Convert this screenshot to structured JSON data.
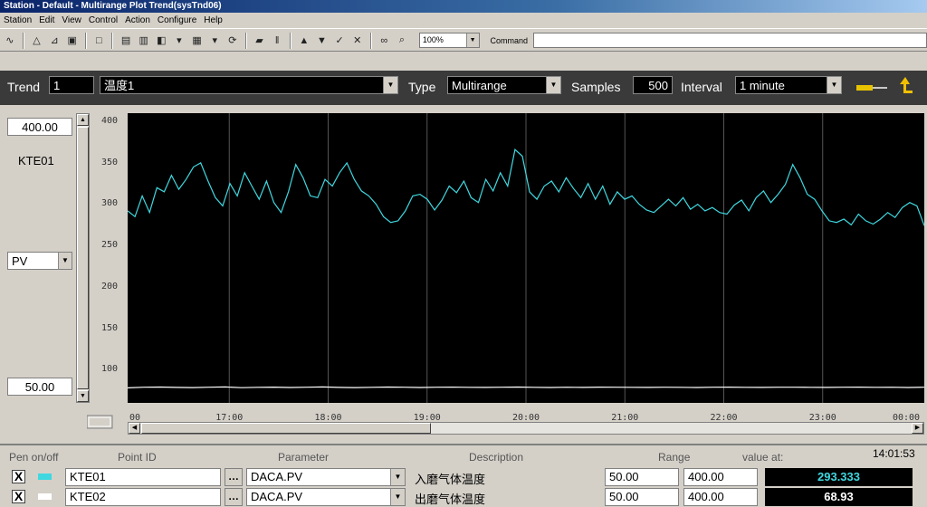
{
  "window": {
    "title": "Station - Default - Multirange Plot Trend(sysTnd06)"
  },
  "menu": [
    "Station",
    "Edit",
    "View",
    "Control",
    "Action",
    "Configure",
    "Help"
  ],
  "toolbar": {
    "zoom": "100%",
    "command_label": "Command",
    "command_value": ""
  },
  "trend": {
    "trend_label": "Trend",
    "trend_number": "1",
    "trend_name": "温度1",
    "type_label": "Type",
    "type_value": "Multirange",
    "samples_label": "Samples",
    "samples_value": "500",
    "interval_label": "Interval",
    "interval_value": "1 minute"
  },
  "left_panel": {
    "range_high": "400.00",
    "pen_id": "KTE01",
    "select_value": "PV",
    "range_low": "50.00"
  },
  "chart_data": {
    "type": "line",
    "y_ticks": [
      "400",
      "350",
      "300",
      "250",
      "200",
      "150",
      "100"
    ],
    "ylim": [
      50,
      400
    ],
    "x_ticks": [
      "00",
      "17:00",
      "18:00",
      "19:00",
      "20:00",
      "21:00",
      "22:00",
      "23:00",
      "00:00"
    ],
    "grid": "vertical",
    "series": [
      {
        "name": "KTE01",
        "color": "#3fd8e0",
        "values": [
          282,
          275,
          300,
          280,
          310,
          305,
          325,
          308,
          320,
          335,
          340,
          318,
          298,
          288,
          315,
          300,
          328,
          312,
          296,
          318,
          292,
          280,
          305,
          338,
          322,
          300,
          298,
          320,
          312,
          328,
          340,
          320,
          306,
          300,
          290,
          275,
          268,
          270,
          282,
          300,
          302,
          296,
          283,
          295,
          312,
          304,
          318,
          298,
          292,
          320,
          306,
          328,
          312,
          356,
          348,
          305,
          296,
          312,
          318,
          305,
          322,
          309,
          298,
          315,
          296,
          312,
          290,
          305,
          296,
          300,
          290,
          283,
          280,
          288,
          296,
          288,
          298,
          284,
          290,
          282,
          286,
          280,
          278,
          289,
          295,
          282,
          298,
          306,
          292,
          302,
          314,
          338,
          322,
          302,
          296,
          282,
          270,
          268,
          272,
          265,
          278,
          270,
          266,
          272,
          280,
          274,
          286,
          292,
          288,
          264
        ]
      },
      {
        "name": "KTE02",
        "color": "#ffffff",
        "values": [
          68.2,
          68.9,
          69.1,
          68.7,
          68.5,
          68.9,
          69.2,
          68.4,
          68.8,
          69.0,
          68.6,
          68.9,
          69.3,
          68.7,
          68.5,
          68.8,
          69.1,
          68.9,
          68.6,
          68.9,
          69.0,
          68.8,
          68.7,
          68.9,
          69.1,
          68.8,
          68.6,
          68.9,
          68.7,
          69.0,
          68.9,
          68.8,
          68.7,
          68.9,
          68.8,
          68.6,
          68.9,
          69.0,
          68.8,
          68.7,
          68.9,
          68.9,
          68.8,
          68.7,
          68.9,
          69.0,
          68.8,
          68.9,
          68.6,
          68.9
        ]
      }
    ]
  },
  "pens": {
    "headers": {
      "onoff": "Pen on/off",
      "pointid": "Point ID",
      "parameter": "Parameter",
      "description": "Description",
      "range": "Range",
      "value_at": "value at:",
      "time": "14:01:53"
    },
    "rows": [
      {
        "checked": "X",
        "point_id": "KTE01",
        "parameter": "DACA.PV",
        "description": "入磨气体温度",
        "range_low": "50.00",
        "range_high": "400.00",
        "value": "293.333",
        "color": "#3fd8e0"
      },
      {
        "checked": "X",
        "point_id": "KTE02",
        "parameter": "DACA.PV",
        "description": "出磨气体温度",
        "range_low": "50.00",
        "range_high": "400.00",
        "value": "68.93",
        "color": "#ffffff"
      }
    ]
  }
}
